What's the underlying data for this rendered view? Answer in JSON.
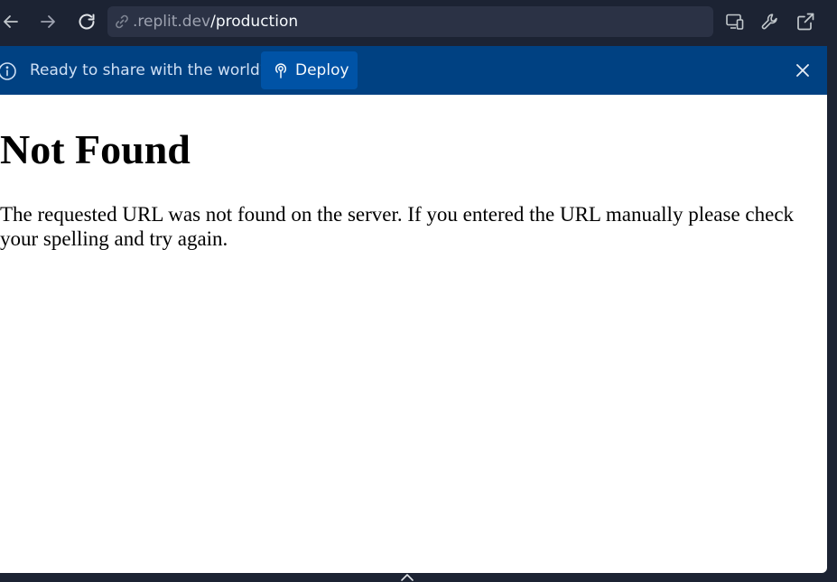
{
  "browser": {
    "url_host": ".replit.dev",
    "url_path": "/production",
    "icons": {
      "back": "arrow-left-icon",
      "forward": "arrow-right-icon",
      "reload": "reload-icon",
      "link": "link-icon",
      "devices": "devices-icon",
      "devtools": "wrench-icon",
      "open_new_tab": "external-link-icon"
    }
  },
  "banner": {
    "text": "Ready to share with the world?",
    "deploy_label": "Deploy",
    "background": "#004182",
    "button_color": "#0053a6"
  },
  "page": {
    "heading": "Not Found",
    "message": "The requested URL was not found on the server. If you entered the URL manually please check your spelling and try again."
  },
  "colors": {
    "toolbar": "#1c2333",
    "url_bar": "#2b3245",
    "icon": "#c2c8cc"
  }
}
